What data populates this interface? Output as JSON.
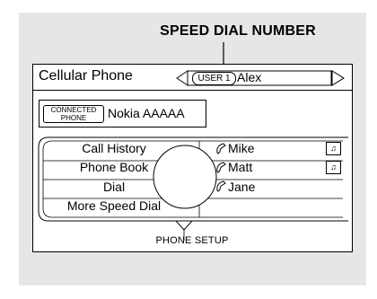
{
  "callout": {
    "label": "SPEED DIAL NUMBER"
  },
  "screen": {
    "title": "Cellular Phone",
    "user": {
      "badge": "USER 1",
      "name": "Alex"
    },
    "device": {
      "badge_line1": "CONNECTED",
      "badge_line2": "PHONE",
      "name": "Nokia AAAAA"
    },
    "menu": [
      {
        "label": "Call History"
      },
      {
        "label": "Phone Book"
      },
      {
        "label": "Dial"
      },
      {
        "label": "More Speed Dial"
      }
    ],
    "speed_dial": [
      {
        "name": "Mike",
        "icon": "handset-icon",
        "voice_tag": true
      },
      {
        "name": "Matt",
        "icon": "handset-icon",
        "voice_tag": true
      },
      {
        "name": "Jane",
        "icon": "handset-icon",
        "voice_tag": false
      }
    ],
    "footer": {
      "label": "PHONE SETUP"
    }
  }
}
